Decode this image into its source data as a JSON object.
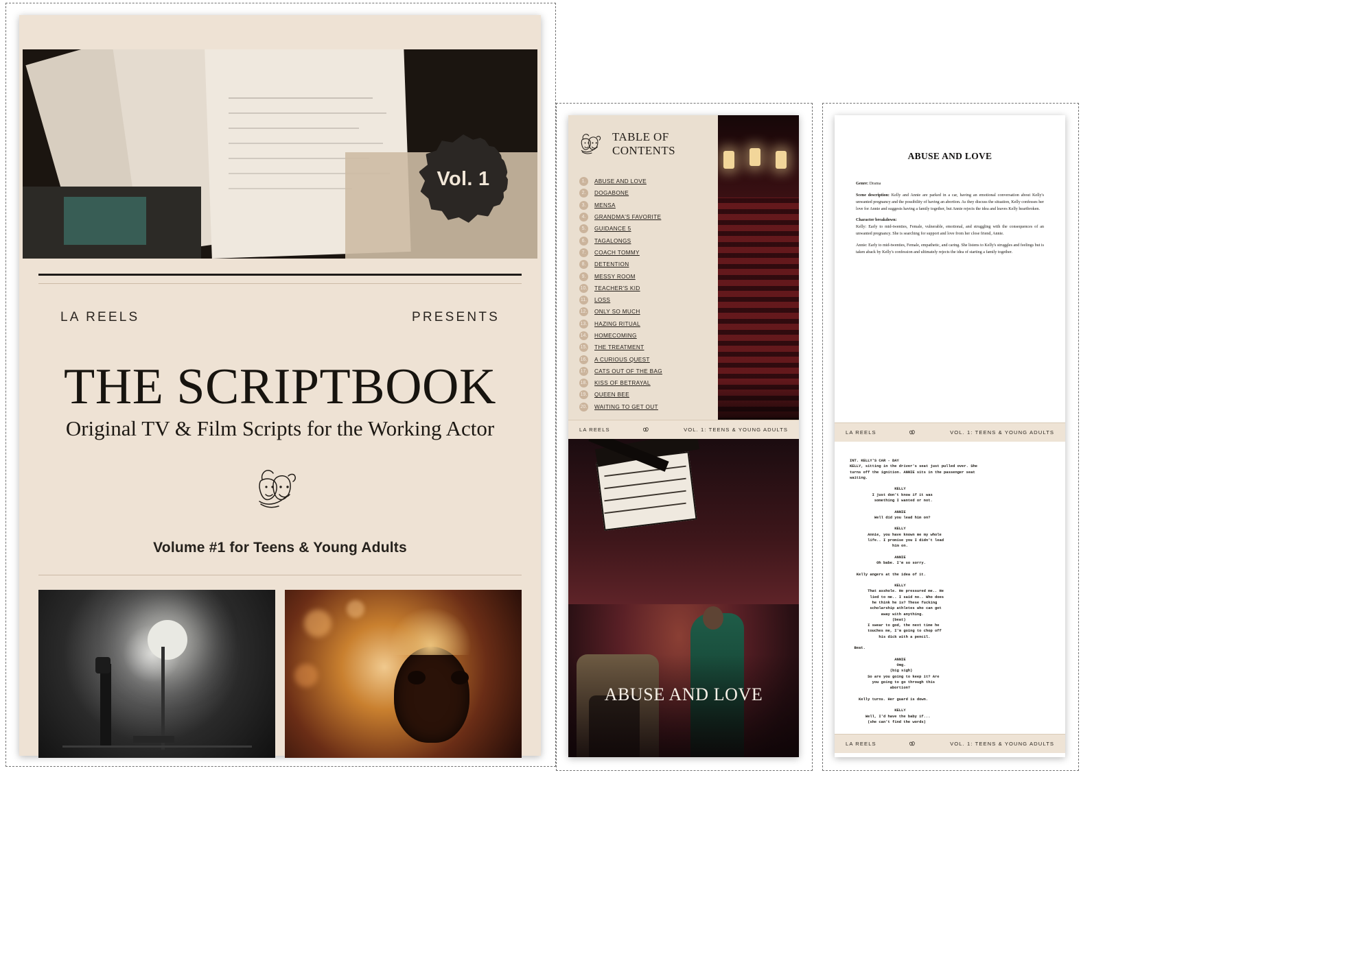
{
  "cover": {
    "badge_label": "Vol. 1",
    "brand": "LA REELS",
    "presents": "PRESENTS",
    "title": "THE SCRIPTBOOK",
    "subtitle": "Original TV & Film Scripts for the Working Actor",
    "volume_line": "Volume #1 for Teens & Young Adults",
    "logo_icon": "theater-masks-icon",
    "hero_photo_alt": "hands-holding-script-pages-photo",
    "photo_left_alt": "film-studio-lighting-photo",
    "photo_right_alt": "masquerade-mask-bokeh-photo"
  },
  "toc_page": {
    "heading_line1": "TABLE OF",
    "heading_line2": "CONTENTS",
    "logo_icon": "theater-masks-icon",
    "side_photo_alt": "empty-theater-seats-photo",
    "items": [
      {
        "num": "1.",
        "label": "ABUSE AND LOVE"
      },
      {
        "num": "2.",
        "label": "DOGABONE"
      },
      {
        "num": "3.",
        "label": "MENSA"
      },
      {
        "num": "4.",
        "label": "GRANDMA'S FAVORITE"
      },
      {
        "num": "5.",
        "label": "GUIDANCE 5"
      },
      {
        "num": "6.",
        "label": "TAGALONGS"
      },
      {
        "num": "7.",
        "label": "COACH TOMMY"
      },
      {
        "num": "8.",
        "label": "DETENTION"
      },
      {
        "num": "9.",
        "label": "MESSY ROOM"
      },
      {
        "num": "10.",
        "label": "TEACHER'S KID"
      },
      {
        "num": "11.",
        "label": "LOSS"
      },
      {
        "num": "12.",
        "label": "ONLY SO MUCH"
      },
      {
        "num": "13.",
        "label": "HAZING RITUAL"
      },
      {
        "num": "14.",
        "label": "HOMECOMING"
      },
      {
        "num": "15.",
        "label": "THE TREATMENT"
      },
      {
        "num": "16.",
        "label": "A CURIOUS QUEST"
      },
      {
        "num": "17.",
        "label": "CATS OUT OF THE BAG"
      },
      {
        "num": "18.",
        "label": "KISS OF BETRAYAL"
      },
      {
        "num": "19.",
        "label": "QUEEN BEE"
      },
      {
        "num": "20.",
        "label": "WAITING TO GET OUT"
      }
    ],
    "hero_caption": "ABUSE AND LOVE",
    "hero_photo_alt": "couple-on-couch-red-light-photo"
  },
  "script_page": {
    "title": "ABUSE AND LOVE",
    "genre_label": "Genre:",
    "genre_value": "Drama",
    "scene_label": "Scene description:",
    "scene_text": " Kelly and Annie are parked in a car, having an emotional conversation about Kelly's unwanted pregnancy and the possibility of having an abortion. As they discuss the situation, Kelly confesses her love for Annie and suggests having a family together, but Annie rejects the idea and leaves Kelly heartbroken.",
    "character_label": "Character breakdown:",
    "character_kelly": "Kelly: Early to mid-twenties, Female, vulnerable, emotional, and struggling with the consequences of an unwanted pregnancy. She is searching for support and love from her close friend, Annie.",
    "character_annie": "Annie: Early to mid-twenties, Female, empathetic, and caring. She listens to Kelly's struggles and feelings but is taken aback by Kelly's confession and ultimately rejects the idea of starting a family together.",
    "screenplay": "INT. KELLY'S CAR - DAY\nKELLY, sitting in the driver's seat just pulled over. She\nturns off the ignition. ANNIE sits in the passenger seat\nwaiting.\n\n                    KELLY\n          I just don't know if it was\n           something I wanted or not.\n\n                    ANNIE\n           Well did you lead him on?\n\n                    KELLY\n        Annie, you have known me my whole\n        life.. I promise you I didn't lead\n                   him on.\n\n                    ANNIE\n            Oh babe. I'm so sorry.\n\n   Kelly angers at the idea of it.\n\n                    KELLY\n        That asshole. He pressured me.. He\n         lied to me.. I said no.. Who does\n          he think he is? These fucking\n         scholarship athletes who can get\n              away with anything.\n                   (beat)\n        I swear to god, the next time he\n        touches me, I'm going to chop off\n             his dick with a pencil.\n\n  Beat.\n\n                    ANNIE\n                     Omg.\n                  (big sigh)\n        So are you going to keep it? Are\n          you going to go through this\n                  abortion?\n\n    Kelly turns. Her guard is down.\n\n                    KELLY\n       Well, I'd have the baby if...\n        (she can't find the words)\n\n                    ANNIE\n\n         If what?\n                    KELLY\n       If you'd have it with me."
  },
  "footer": {
    "brand": "LA REELS",
    "icon": "theater-masks-icon",
    "volume": "VOL. 1: TEENS & YOUNG ADULTS"
  },
  "colors": {
    "cream": "#eee2d4",
    "cream_light": "#eadfd0",
    "dark": "#1d1a17",
    "badge": "#2b2724",
    "toc_num": "#cbb49c",
    "rule_light": "#cbb9a5"
  }
}
